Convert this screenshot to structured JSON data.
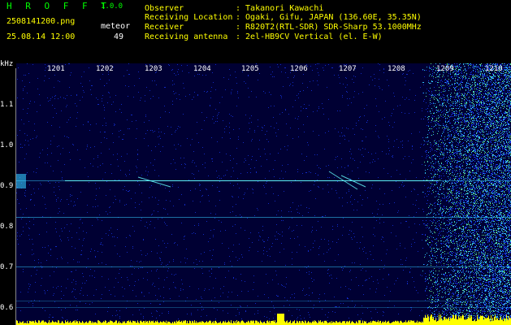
{
  "header": {
    "app_title": "H R O F F T",
    "app_version": "1.0.0",
    "file_name": "2508141200.png",
    "timestamp": "25.08.14 12:00",
    "meteor_label": "meteor",
    "meteor_count": "49"
  },
  "station_info": [
    {
      "label": "Observer",
      "value": ": Takanori Kawachi"
    },
    {
      "label": "Receiving Location",
      "value": ": Ogaki, Gifu, JAPAN (136.60E, 35.35N)"
    },
    {
      "label": "Receiver",
      "value": ": R820T2(RTL-SDR) SDR-Sharp 53.1000MHz"
    },
    {
      "label": "Receiving antenna",
      "value": ": 2el-HB9CV Vertical (el. E-W)"
    }
  ],
  "y_axis": {
    "unit_label": "kHz",
    "ticks": [
      "1.1",
      "1.0",
      "0.9",
      "0.8",
      "0.7",
      "0.6"
    ]
  },
  "x_axis": {
    "ticks": [
      "1201",
      "1202",
      "1203",
      "1204",
      "1205",
      "1206",
      "1207",
      "1208",
      "1209",
      "1210"
    ]
  },
  "colors": {
    "background": "#000000",
    "header_green": "#00ff00",
    "header_yellow": "#ffff00",
    "spectrogram_base": "#000033",
    "noise_blue": "#1a3cff",
    "noise_cyan": "#33ccff",
    "noise_green": "#66ff99",
    "signal_cyan": "#66ffff",
    "amplitude_bar": "#ffff00"
  }
}
